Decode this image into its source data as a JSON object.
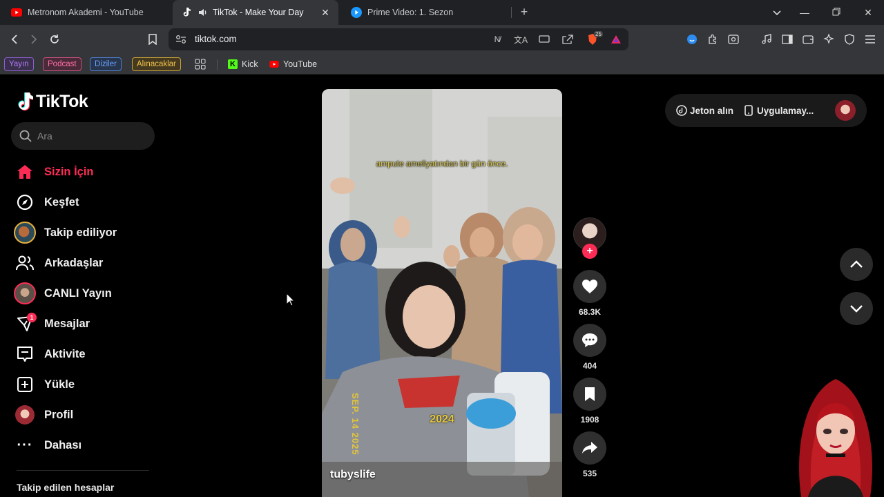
{
  "browser": {
    "tabs": [
      {
        "title": "Metronom Akademi - YouTube",
        "active": false,
        "favicon": "youtube-icon"
      },
      {
        "title": "TikTok - Make Your Day",
        "active": true,
        "favicon": "tiktok-icon",
        "audio": true
      },
      {
        "title": "Prime Video: 1. Sezon",
        "active": false,
        "favicon": "prime-video-icon"
      }
    ],
    "url": "tiktok.com",
    "brave_badge": "25",
    "bookmarks_tags": [
      {
        "label": "Yayın",
        "color": "#b07cf0"
      },
      {
        "label": "Podcast",
        "color": "#ff6fa7"
      },
      {
        "label": "Diziler",
        "color": "#6aa3ff"
      },
      {
        "label": "Alınacaklar",
        "color": "#f3c64b"
      }
    ],
    "bookmarks_links": [
      {
        "label": "Kick",
        "icon": "kick-icon"
      },
      {
        "label": "YouTube",
        "icon": "youtube-icon"
      }
    ]
  },
  "tiktok": {
    "logo": "TikTok",
    "search_placeholder": "Ara",
    "nav": [
      {
        "label": "Sizin İçin",
        "icon": "home-icon",
        "active": true
      },
      {
        "label": "Keşfet",
        "icon": "compass-icon"
      },
      {
        "label": "Takip ediliyor",
        "icon": "following-avatar-icon"
      },
      {
        "label": "Arkadaşlar",
        "icon": "friends-icon"
      },
      {
        "label": "CANLI Yayın",
        "icon": "live-avatar-icon"
      },
      {
        "label": "Mesajlar",
        "icon": "messages-icon",
        "badge": "1"
      },
      {
        "label": "Aktivite",
        "icon": "activity-icon"
      },
      {
        "label": "Yükle",
        "icon": "upload-icon"
      },
      {
        "label": "Profil",
        "icon": "profile-avatar-icon"
      },
      {
        "label": "Dahası",
        "icon": "more-icon"
      }
    ],
    "followed_heading": "Takip edilen hesaplar",
    "video": {
      "caption": "ampute ameliyatından bir gün önce.",
      "year_overlay": "2024",
      "date_overlay": "SEP. 14 2025",
      "author": "tubyslife"
    },
    "actions": {
      "likes": "68.3K",
      "comments": "404",
      "saves": "1908",
      "shares": "535"
    },
    "top_right": {
      "coins": "Jeton alın",
      "app": "Uygulamay..."
    },
    "colors": {
      "accent": "#fe2c55"
    }
  }
}
